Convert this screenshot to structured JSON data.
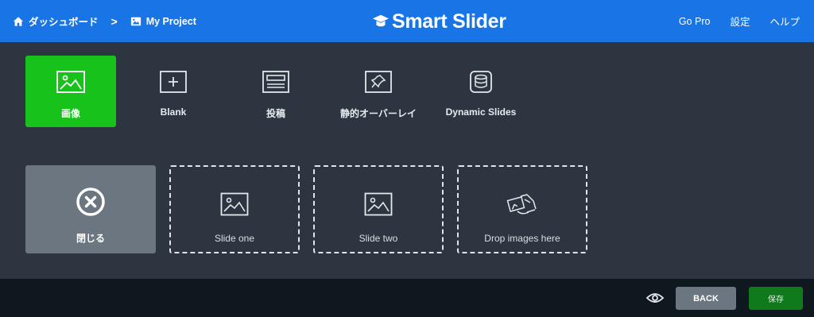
{
  "breadcrumbs": {
    "dashboard_label": "ダッシュボード",
    "separator": ">",
    "project_label": "My Project"
  },
  "logo": {
    "text": "Smart Slider"
  },
  "topnav": {
    "go_pro": "Go Pro",
    "settings": "設定",
    "help": "ヘルプ"
  },
  "slide_types": [
    {
      "label": "画像",
      "icon": "image-icon",
      "active": true
    },
    {
      "label": "Blank",
      "icon": "plus-box-icon",
      "active": false
    },
    {
      "label": "投稿",
      "icon": "post-icon",
      "active": false
    },
    {
      "label": "静的オーバーレイ",
      "icon": "pin-icon",
      "active": false
    },
    {
      "label": "Dynamic Slides",
      "icon": "database-icon",
      "active": false
    }
  ],
  "cards": {
    "close_label": "閉じる",
    "slide_one": "Slide one",
    "slide_two": "Slide two",
    "drop": "Drop images here"
  },
  "bottom": {
    "back_label": "BACK",
    "save_label": "保存"
  },
  "colors": {
    "topbar": "#1975e6",
    "active": "#17c21a",
    "save": "#0e7a1b",
    "background": "#2c3540"
  }
}
